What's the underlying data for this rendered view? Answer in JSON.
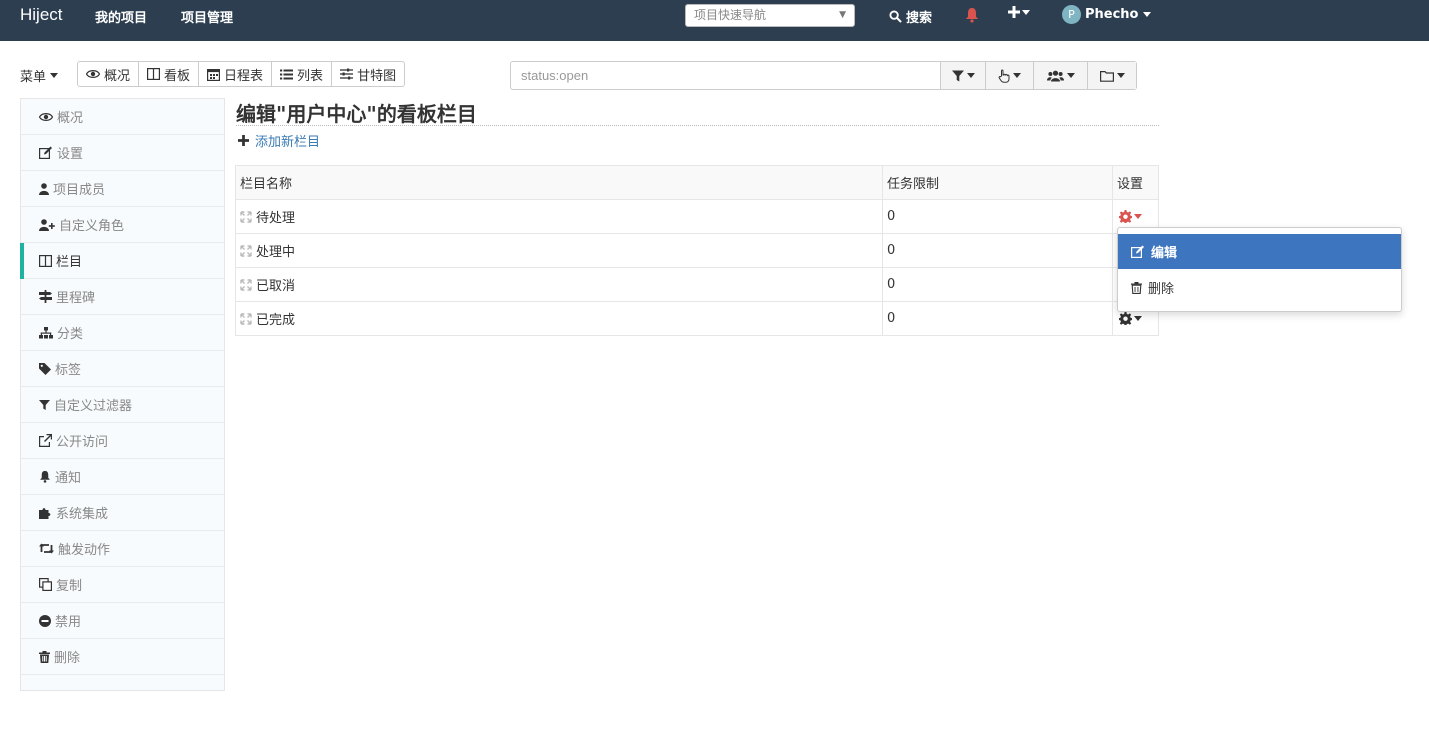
{
  "colors": {
    "navbar": "#2c3e50",
    "accent": "#20b2a0",
    "link": "#3a7ab3",
    "danger": "#d9534f",
    "highlight": "#3d75bf"
  },
  "topbar": {
    "brand": "Hiject",
    "nav": [
      "我的项目",
      "项目管理"
    ],
    "quick_nav_placeholder": "项目快速导航",
    "search_label": "搜索",
    "user_initial": "P",
    "user_name": "Phecho"
  },
  "toolbar": {
    "menu_label": "菜单",
    "views": [
      {
        "label": "概况",
        "icon": "eye-icon"
      },
      {
        "label": "看板",
        "icon": "columns-icon"
      },
      {
        "label": "日程表",
        "icon": "calendar-icon"
      },
      {
        "label": "列表",
        "icon": "list-icon"
      },
      {
        "label": "甘特图",
        "icon": "sliders-icon"
      }
    ],
    "filter_value": "status:open"
  },
  "sidebar": {
    "items": [
      {
        "label": "概况",
        "icon": "eye-icon"
      },
      {
        "label": "设置",
        "icon": "edit-icon"
      },
      {
        "label": "项目成员",
        "icon": "user-icon"
      },
      {
        "label": "自定义角色",
        "icon": "user-plus-icon"
      },
      {
        "label": "栏目",
        "icon": "columns-icon",
        "active": true
      },
      {
        "label": "里程碑",
        "icon": "signs-icon"
      },
      {
        "label": "分类",
        "icon": "sitemap-icon"
      },
      {
        "label": "标签",
        "icon": "tag-icon"
      },
      {
        "label": "自定义过滤器",
        "icon": "filter-icon"
      },
      {
        "label": "公开访问",
        "icon": "external-link-icon"
      },
      {
        "label": "通知",
        "icon": "bell-icon"
      },
      {
        "label": "系统集成",
        "icon": "puzzle-icon"
      },
      {
        "label": "触发动作",
        "icon": "retweet-icon"
      },
      {
        "label": "复制",
        "icon": "copy-icon"
      },
      {
        "label": "禁用",
        "icon": "minus-circle-icon"
      },
      {
        "label": "删除",
        "icon": "trash-icon"
      }
    ]
  },
  "main": {
    "title": "编辑\"用户中心\"的看板栏目",
    "add_column_label": "添加新栏目",
    "table": {
      "headers": [
        "栏目名称",
        "任务限制",
        "设置"
      ],
      "rows": [
        {
          "name": "待处理",
          "limit": "0"
        },
        {
          "name": "处理中",
          "limit": "0"
        },
        {
          "name": "已取消",
          "limit": "0"
        },
        {
          "name": "已完成",
          "limit": "0"
        }
      ]
    }
  },
  "dropdown": {
    "edit_label": "编辑",
    "delete_label": "删除"
  }
}
